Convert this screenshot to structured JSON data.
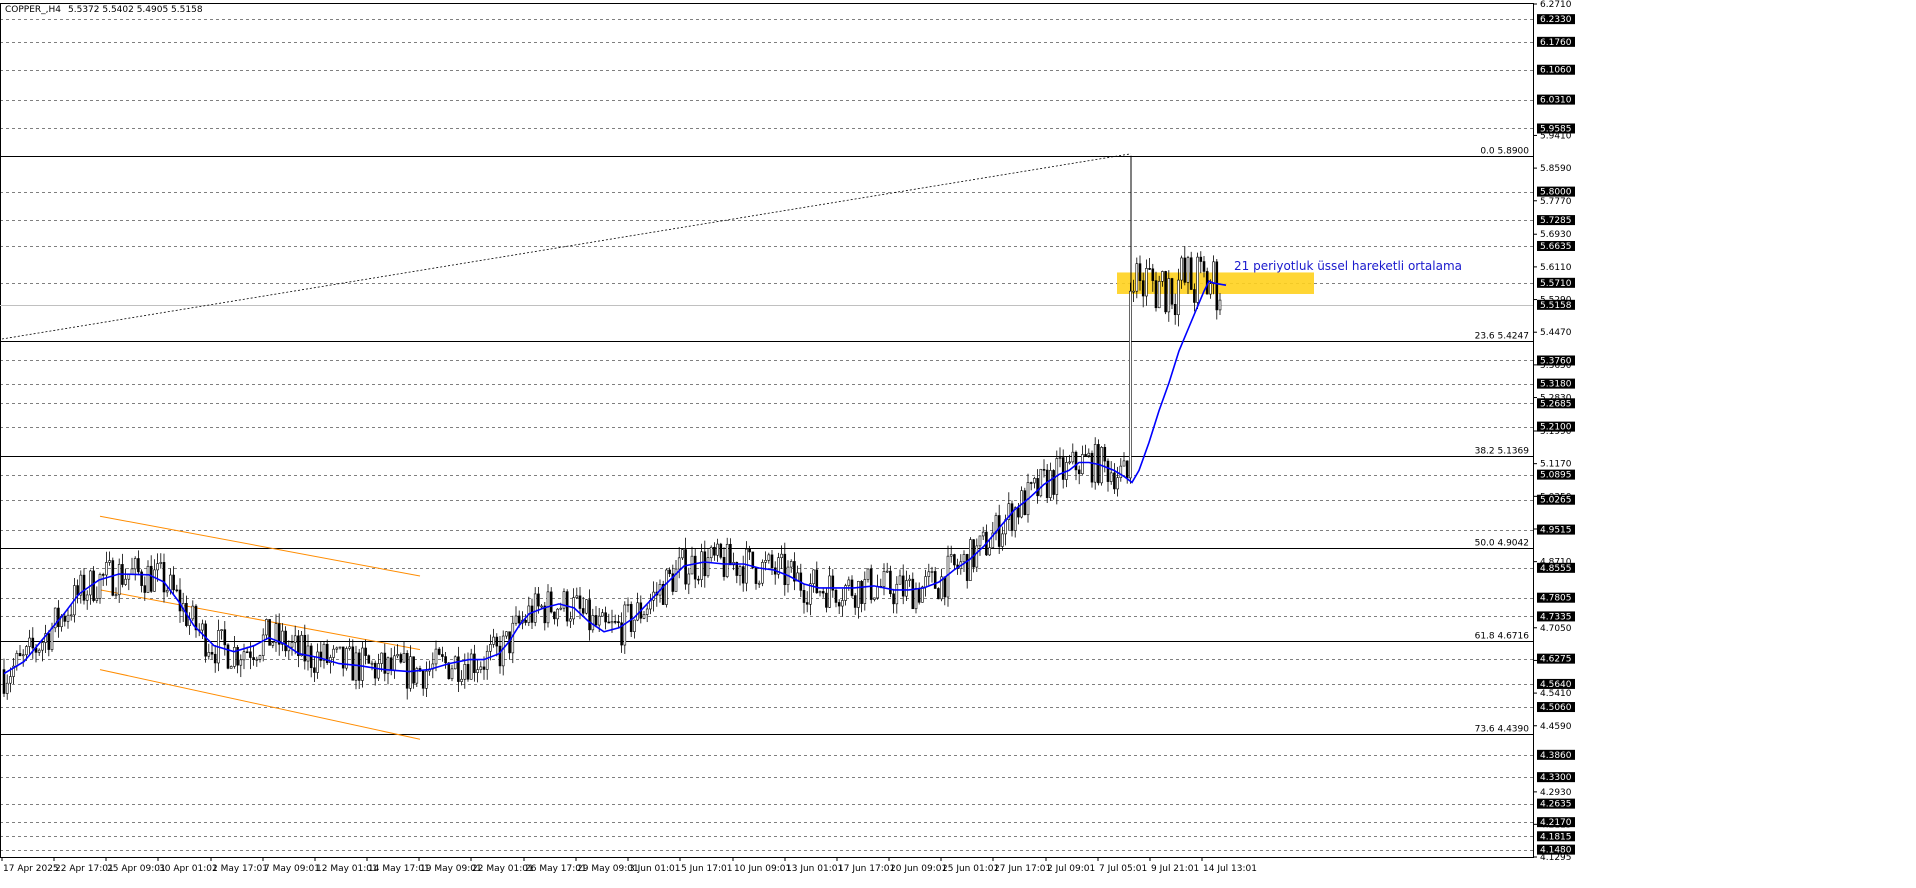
{
  "header": {
    "symbol": "COPPER_,H4",
    "ohlc": "5.5372 5.5402 5.4905 5.5158"
  },
  "annotation": {
    "text": "21 periyotluk üssel hareketli ortalama"
  },
  "colors": {
    "background": "#ffffff",
    "grid": "#000000",
    "ema": "#0000ff",
    "channel": "#ff8c00",
    "zone": "#ffd21e",
    "text": "#1a1acd",
    "badge": "#000000"
  },
  "chart_data": {
    "type": "candlestick",
    "ylim": [
      4.1295,
      6.271
    ],
    "grid": true,
    "price_ticks_plain": [
      "6.2710",
      "5.9410",
      "5.8590",
      "5.7770",
      "5.6930",
      "5.6110",
      "5.5290",
      "5.4470",
      "5.3650",
      "5.2830",
      "5.1990",
      "5.1170",
      "5.0350",
      "4.9530",
      "4.8710",
      "4.7050",
      "4.6230",
      "4.5410",
      "4.4590",
      "4.2930",
      "4.2115",
      "4.1295"
    ],
    "price_ticks_badge": [
      "6.2330",
      "6.1760",
      "6.1060",
      "6.0310",
      "5.9585",
      "5.8000",
      "5.7285",
      "5.6635",
      "5.5710",
      "5.5158",
      "5.3760",
      "5.3180",
      "5.2685",
      "5.2100",
      "5.0895",
      "5.0265",
      "4.9515",
      "4.8555",
      "4.7805",
      "4.7335",
      "4.6275",
      "4.5640",
      "4.5060",
      "4.3860",
      "4.3300",
      "4.2635",
      "4.2170",
      "4.1815",
      "4.1480"
    ],
    "x_labels": [
      "17 Apr 2025",
      "22 Apr 17:01",
      "25 Apr 09:01",
      "30 Apr 01:01",
      "2 May 17:01",
      "7 May 09:01",
      "12 May 01:01",
      "14 May 17:01",
      "19 May 09:01",
      "22 May 01:01",
      "26 May 17:01",
      "29 May 09:01",
      "3 Jun 01:01",
      "5 Jun 17:01",
      "10 Jun 09:01",
      "13 Jun 01:01",
      "17 Jun 17:01",
      "20 Jun 09:01",
      "25 Jun 01:01",
      "27 Jun 17:01",
      "2 Jul 09:01",
      "7 Jul 05:01",
      "9 Jul 21:01",
      "14 Jul 13:01"
    ],
    "fib_levels": [
      {
        "label": "0.0 5.8900",
        "price": 5.89
      },
      {
        "label": "23.6 5.4247",
        "price": 5.4247
      },
      {
        "label": "38.2 5.1369",
        "price": 5.1369
      },
      {
        "label": "50.0 4.9042",
        "price": 4.9042
      },
      {
        "label": "61.8 4.6716",
        "price": 4.6716
      },
      {
        "label": "73.6 4.4390",
        "price": 4.439
      }
    ],
    "current_price": 5.5158,
    "zone": {
      "from": 5.543,
      "to": 5.597
    },
    "channel_upper": [
      [
        0,
        4.985
      ],
      [
        320,
        4.835
      ]
    ],
    "channel_mid": [
      [
        0,
        4.8
      ],
      [
        320,
        4.65
      ]
    ],
    "channel_lower": [
      [
        0,
        4.6
      ],
      [
        320,
        4.425
      ]
    ],
    "trendline": [
      [
        0,
        5.43
      ],
      [
        1105,
        5.895
      ]
    ],
    "ema_path": [
      [
        0,
        4.59
      ],
      [
        20,
        4.62
      ],
      [
        40,
        4.68
      ],
      [
        60,
        4.74
      ],
      [
        75,
        4.79
      ],
      [
        95,
        4.825
      ],
      [
        115,
        4.84
      ],
      [
        145,
        4.838
      ],
      [
        160,
        4.82
      ],
      [
        175,
        4.77
      ],
      [
        190,
        4.71
      ],
      [
        210,
        4.66
      ],
      [
        230,
        4.645
      ],
      [
        250,
        4.66
      ],
      [
        265,
        4.68
      ],
      [
        280,
        4.665
      ],
      [
        295,
        4.64
      ],
      [
        315,
        4.63
      ],
      [
        335,
        4.615
      ],
      [
        355,
        4.61
      ],
      [
        380,
        4.6
      ],
      [
        405,
        4.595
      ],
      [
        425,
        4.6
      ],
      [
        445,
        4.615
      ],
      [
        465,
        4.625
      ],
      [
        480,
        4.625
      ],
      [
        495,
        4.64
      ],
      [
        505,
        4.67
      ],
      [
        515,
        4.71
      ],
      [
        525,
        4.74
      ],
      [
        540,
        4.755
      ],
      [
        555,
        4.765
      ],
      [
        570,
        4.755
      ],
      [
        585,
        4.72
      ],
      [
        600,
        4.695
      ],
      [
        615,
        4.705
      ],
      [
        630,
        4.73
      ],
      [
        645,
        4.77
      ],
      [
        660,
        4.81
      ],
      [
        680,
        4.86
      ],
      [
        700,
        4.87
      ],
      [
        720,
        4.865
      ],
      [
        740,
        4.865
      ],
      [
        755,
        4.855
      ],
      [
        770,
        4.85
      ],
      [
        785,
        4.835
      ],
      [
        800,
        4.815
      ],
      [
        815,
        4.805
      ],
      [
        830,
        4.805
      ],
      [
        850,
        4.805
      ],
      [
        870,
        4.81
      ],
      [
        890,
        4.8
      ],
      [
        905,
        4.8
      ],
      [
        920,
        4.805
      ],
      [
        935,
        4.82
      ],
      [
        950,
        4.85
      ],
      [
        965,
        4.875
      ],
      [
        980,
        4.91
      ],
      [
        995,
        4.955
      ],
      [
        1010,
        5.0
      ],
      [
        1025,
        5.03
      ],
      [
        1040,
        5.065
      ],
      [
        1055,
        5.09
      ],
      [
        1065,
        5.1
      ],
      [
        1075,
        5.12
      ],
      [
        1085,
        5.12
      ],
      [
        1095,
        5.115
      ],
      [
        1110,
        5.1
      ],
      [
        1120,
        5.085
      ],
      [
        1128,
        5.07
      ],
      [
        1135,
        5.1
      ],
      [
        1145,
        5.17
      ],
      [
        1155,
        5.25
      ],
      [
        1165,
        5.32
      ],
      [
        1175,
        5.4
      ],
      [
        1185,
        5.46
      ],
      [
        1195,
        5.52
      ],
      [
        1200,
        5.55
      ],
      [
        1205,
        5.575
      ],
      [
        1210,
        5.57
      ],
      [
        1222,
        5.565
      ]
    ]
  }
}
